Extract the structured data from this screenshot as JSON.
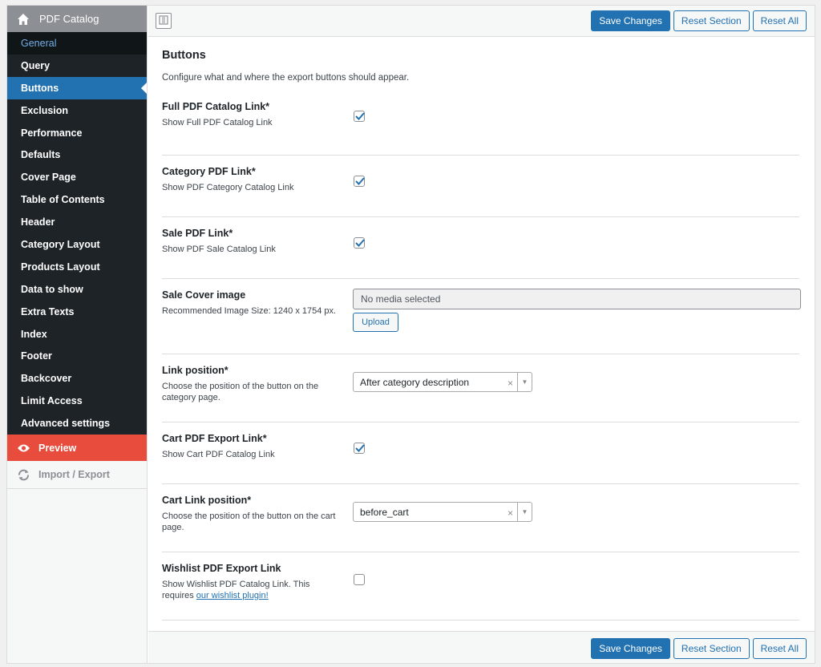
{
  "sidebar": {
    "title": "PDF Catalog",
    "items": [
      {
        "label": "General",
        "id": "general"
      },
      {
        "label": "Query",
        "id": "query"
      },
      {
        "label": "Buttons",
        "id": "buttons"
      },
      {
        "label": "Exclusion",
        "id": "exclusion"
      },
      {
        "label": "Performance",
        "id": "performance"
      },
      {
        "label": "Defaults",
        "id": "defaults"
      },
      {
        "label": "Cover Page",
        "id": "cover-page"
      },
      {
        "label": "Table of Contents",
        "id": "table-of-contents"
      },
      {
        "label": "Header",
        "id": "header"
      },
      {
        "label": "Category Layout",
        "id": "category-layout"
      },
      {
        "label": "Products Layout",
        "id": "products-layout"
      },
      {
        "label": "Data to show",
        "id": "data-to-show"
      },
      {
        "label": "Extra Texts",
        "id": "extra-texts"
      },
      {
        "label": "Index",
        "id": "index"
      },
      {
        "label": "Footer",
        "id": "footer"
      },
      {
        "label": "Backcover",
        "id": "backcover"
      },
      {
        "label": "Limit Access",
        "id": "limit-access"
      },
      {
        "label": "Advanced settings",
        "id": "advanced-settings"
      }
    ],
    "active": "Buttons",
    "preview_label": "Preview",
    "import_export_label": "Import / Export"
  },
  "toolbar": {
    "save_label": "Save Changes",
    "reset_section_label": "Reset Section",
    "reset_all_label": "Reset All"
  },
  "section": {
    "title": "Buttons",
    "description": "Configure what and where the export buttons should appear."
  },
  "fields": {
    "full_pdf": {
      "label": "Full PDF Catalog Link*",
      "sub": "Show Full PDF Catalog Link",
      "checked": true
    },
    "category_pdf": {
      "label": "Category PDF Link*",
      "sub": "Show PDF Category Catalog Link",
      "checked": true
    },
    "sale_pdf": {
      "label": "Sale PDF Link*",
      "sub": "Show PDF Sale Catalog Link",
      "checked": true
    },
    "sale_cover": {
      "label": "Sale Cover image",
      "sub": "Recommended Image Size: 1240 x 1754 px.",
      "placeholder": "No media selected",
      "upload_label": "Upload"
    },
    "link_position": {
      "label": "Link position*",
      "sub": "Choose the position of the button on the category page.",
      "value": "After category description"
    },
    "cart_pdf": {
      "label": "Cart PDF Export Link*",
      "sub": "Show Cart PDF Catalog Link",
      "checked": true
    },
    "cart_link_position": {
      "label": "Cart Link position*",
      "sub": "Choose the position of the button on the cart page.",
      "value": "before_cart"
    },
    "wishlist_pdf": {
      "label": "Wishlist PDF Export Link",
      "sub_prefix": "Show Wishlist PDF Catalog Link. This requires ",
      "sub_link": "our wishlist plugin!",
      "checked": false
    }
  },
  "colors": {
    "accent": "#2271b1",
    "sidebar_dark": "#1d2327",
    "preview_red": "#e74c3c"
  }
}
